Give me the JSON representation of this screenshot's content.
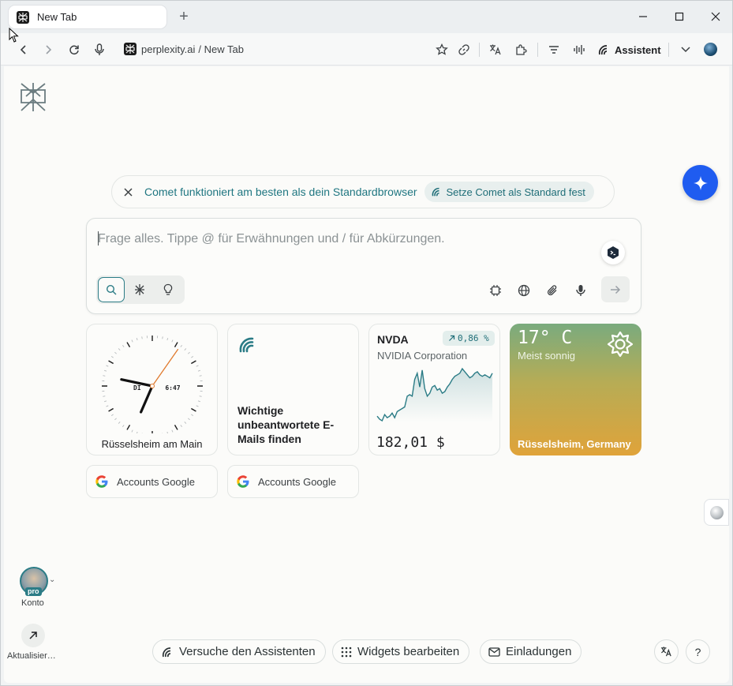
{
  "tab": {
    "title": "New Tab"
  },
  "toolbar": {
    "url_domain": "perplexity.ai",
    "url_path": "/ New Tab",
    "assistant_label": "Assistent"
  },
  "banner": {
    "text": "Comet funktioniert am besten als dein Standardbrowser",
    "cta": "Setze Comet als Standard fest"
  },
  "search": {
    "placeholder": "Frage alles. Tippe @ für Erwähnungen und / für Abkürzungen."
  },
  "widgets": {
    "clock": {
      "city": "Rüsselsheim am Main",
      "day": "DI",
      "time": "6:47"
    },
    "task": {
      "text": "Wichtige unbeantwortete E-Mails finden"
    },
    "stock": {
      "ticker": "NVDA",
      "change": "0,86 %",
      "name": "NVIDIA Corporation",
      "price": "182,01 $",
      "prices": [
        3,
        1,
        0,
        4,
        2,
        3,
        5,
        2,
        6,
        7,
        8,
        9,
        16,
        17,
        16,
        27,
        31,
        22,
        33,
        21,
        16,
        18,
        22,
        23,
        20,
        21,
        18,
        19,
        22,
        24,
        27,
        29,
        30,
        31,
        34,
        32,
        30,
        28,
        29,
        31,
        32,
        30,
        29,
        30,
        29,
        28,
        31
      ]
    },
    "weather": {
      "temp": "17° C",
      "condition": "Meist sonnig",
      "location": "Rüsselsheim, Germany"
    }
  },
  "shortcuts": [
    {
      "label": "Accounts Google"
    },
    {
      "label": "Accounts Google"
    }
  ],
  "account": {
    "badge": "pro",
    "label": "Konto"
  },
  "update": {
    "label": "Aktualisier…"
  },
  "bottom": {
    "assistant": "Versuche den Assistenten",
    "widgets": "Widgets bearbeiten",
    "invites": "Einladungen"
  },
  "colors": {
    "accent": "#1f7681",
    "fab": "#1f5cf0",
    "chart": "#2b7c86"
  }
}
